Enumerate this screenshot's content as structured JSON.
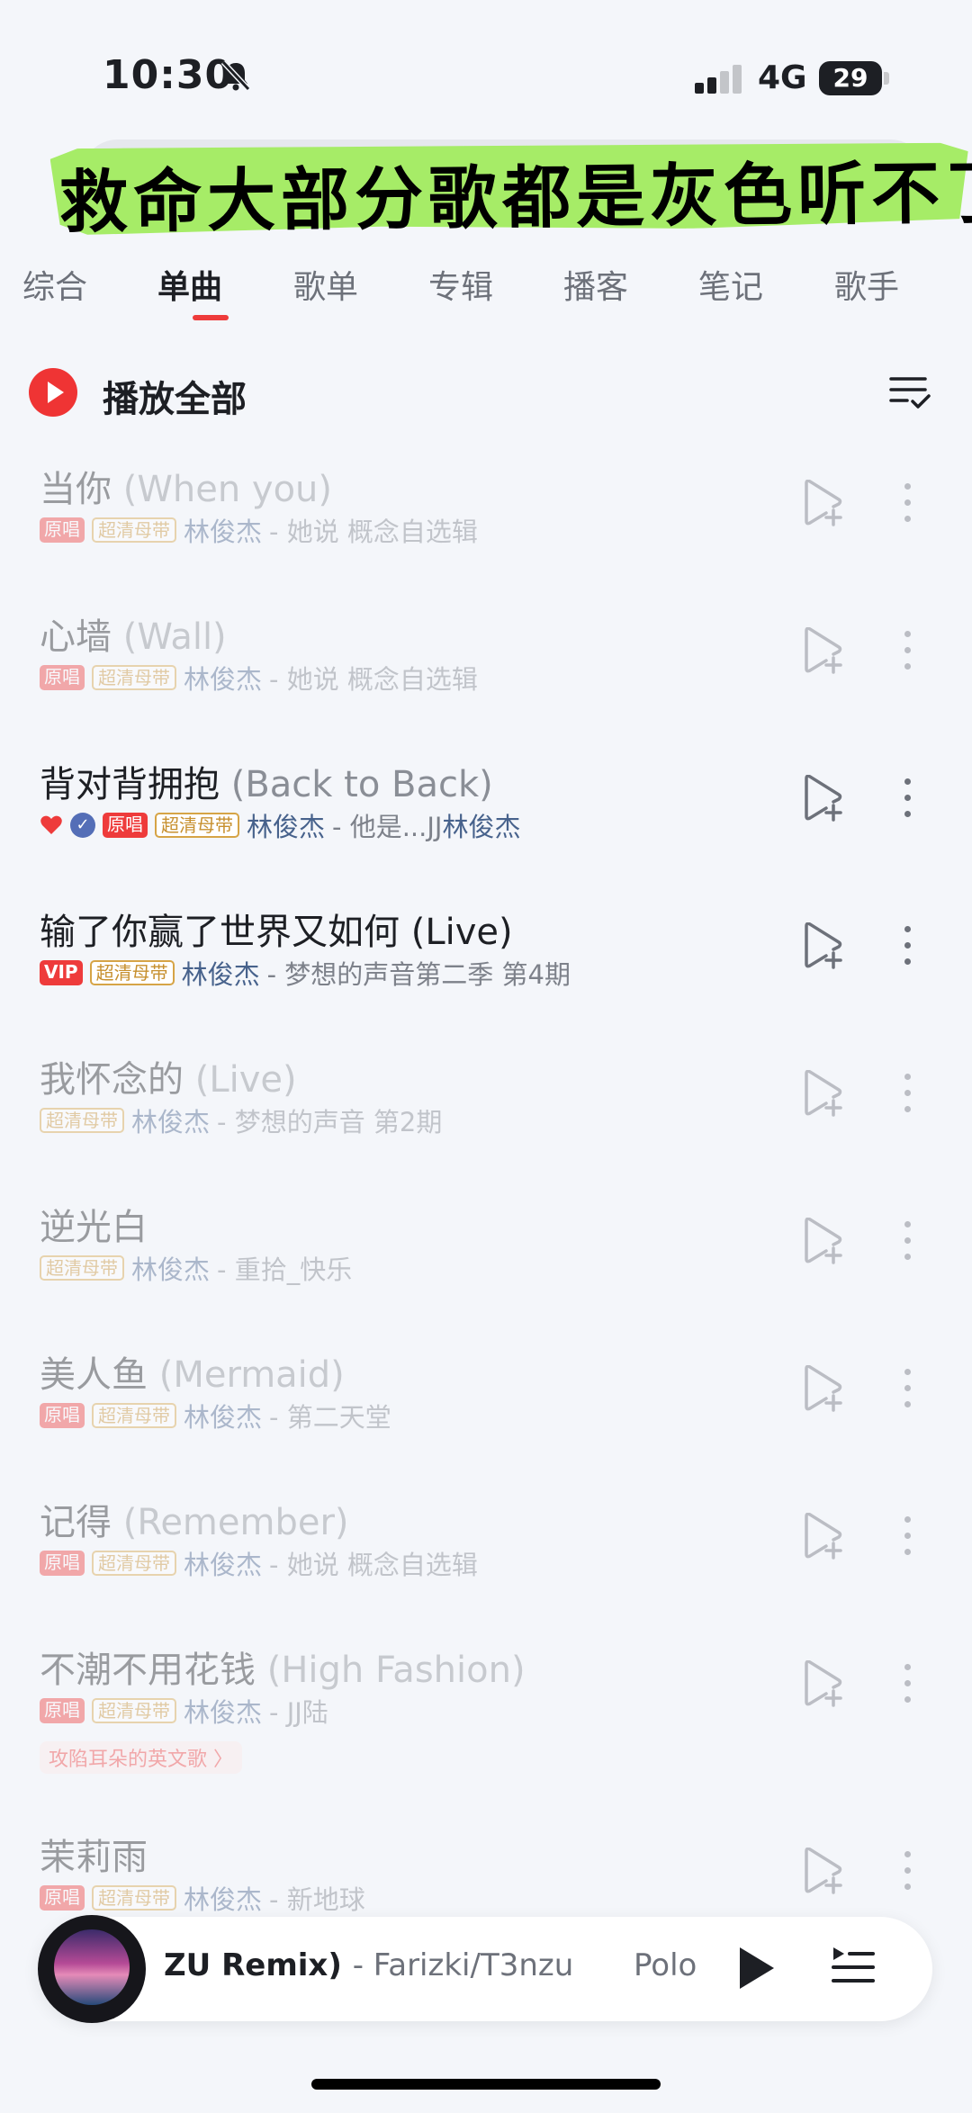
{
  "status": {
    "time": "10:30",
    "network": "4G",
    "battery": "29"
  },
  "caption": {
    "text": "救命大部分歌都是灰色听不了"
  },
  "tabs": [
    "综合",
    "单曲",
    "歌单",
    "专辑",
    "播客",
    "笔记",
    "歌手"
  ],
  "active_tab": "单曲",
  "play_all": {
    "label": "播放全部"
  },
  "songs": [
    {
      "title": "当你",
      "title_en": "(When you)",
      "tags": [
        "原唱",
        "超清母带"
      ],
      "artist": "林俊杰",
      "album": "- 她说 概念自选辑",
      "playable": false
    },
    {
      "title": "心墙",
      "title_en": "(Wall)",
      "tags": [
        "原唱",
        "超清母带"
      ],
      "artist": "林俊杰",
      "album": "- 她说 概念自选辑",
      "playable": false
    },
    {
      "title": "背对背拥抱",
      "title_en": "(Back to Back)",
      "tags": [
        "原唱",
        "超清母带"
      ],
      "artist": "林俊杰",
      "album": "- 他是...JJ",
      "album_artist": "林俊杰",
      "playable": true,
      "liked": true,
      "verified": true
    },
    {
      "title": "输了你赢了世界又如何",
      "title_en": "(Live)",
      "tags": [
        "VIP",
        "超清母带"
      ],
      "artist": "林俊杰",
      "album": "- 梦想的声音第二季 第4期",
      "playable": true
    },
    {
      "title": "我怀念的",
      "title_en": "(Live)",
      "tags": [
        "超清母带"
      ],
      "artist": "林俊杰",
      "album": "- 梦想的声音 第2期",
      "playable": false
    },
    {
      "title": "逆光白",
      "title_en": "",
      "tags": [
        "超清母带"
      ],
      "artist": "林俊杰",
      "album": "- 重拾_快乐",
      "playable": false
    },
    {
      "title": "美人鱼",
      "title_en": "(Mermaid)",
      "tags": [
        "原唱",
        "超清母带"
      ],
      "artist": "林俊杰",
      "album": "- 第二天堂",
      "playable": false
    },
    {
      "title": "记得",
      "title_en": "(Remember)",
      "tags": [
        "原唱",
        "超清母带"
      ],
      "artist": "林俊杰",
      "album": "- 她说 概念自选辑",
      "playable": false
    },
    {
      "title": "不潮不用花钱",
      "title_en": "(High Fashion)",
      "tags": [
        "原唱",
        "超清母带"
      ],
      "artist": "林俊杰",
      "album": "- JJ陆",
      "chip": "攻陷耳朵的英文歌 〉",
      "playable": false
    },
    {
      "title": "茉莉雨",
      "title_en": "",
      "tags": [
        "原唱",
        "超清母带"
      ],
      "artist": "林俊杰",
      "album": "- 新地球",
      "playable": false
    }
  ],
  "player": {
    "title": "ZU Remix)",
    "artist": "- Farizki/T3nzu",
    "next": "Polo"
  }
}
